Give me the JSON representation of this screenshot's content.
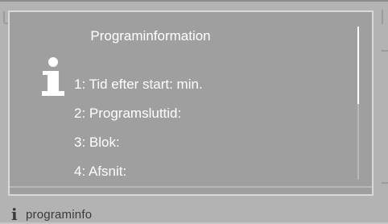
{
  "background": {
    "footer_label": "programinfo"
  },
  "dialog": {
    "title": "Programinformation",
    "rows": [
      {
        "label": "1:  Tid efter start:  min."
      },
      {
        "label": "2:  Programsluttid:"
      },
      {
        "label": "3:  Blok:"
      },
      {
        "label": "4:  Afsnit:"
      }
    ],
    "icon": "info-icon",
    "scroll_position_fraction": 0.0
  },
  "colors": {
    "dialog_bg": "#9f9f9f",
    "dialog_border": "#d9d9d9",
    "text": "#ffffff"
  }
}
